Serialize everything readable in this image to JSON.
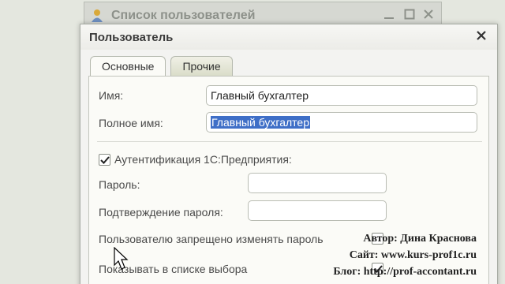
{
  "background_window": {
    "title": "Список пользователей"
  },
  "dialog": {
    "title": "Пользователь",
    "tabs": [
      {
        "label": "Основные",
        "active": true
      },
      {
        "label": "Прочие",
        "active": false
      }
    ],
    "fields": {
      "name_label": "Имя:",
      "name_value": "Главный бухгалтер",
      "fullname_label": "Полное имя:",
      "fullname_value": "Главный бухгалтер",
      "auth_label": "Аутентификация 1С:Предприятия:",
      "password_label": "Пароль:",
      "password_value": "",
      "confirm_label": "Подтверждение пароля:",
      "confirm_value": "",
      "no_change_label": "Пользователю запрещено изменять пароль",
      "show_in_list_label": "Показывать в списке выбора"
    }
  },
  "watermark": {
    "line1": "Автор: Дина Краснова",
    "line2": "Сайт: www.kurs-prof1c.ru",
    "line3": "Блог: http://prof-accontant.ru"
  }
}
